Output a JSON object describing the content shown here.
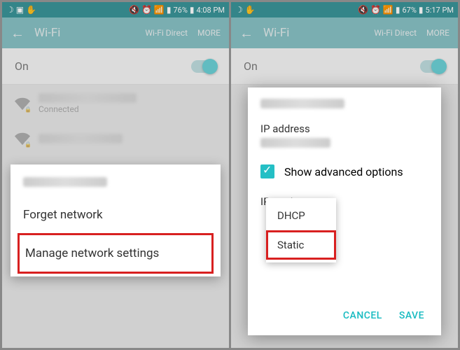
{
  "left": {
    "status": {
      "battery_pct": "76%",
      "time": "4:08 PM"
    },
    "appbar": {
      "title": "Wi-Fi",
      "direct": "Wi-Fi Direct",
      "more": "MORE"
    },
    "toggle_label": "On",
    "network1_status": "Connected",
    "menu": {
      "forget": "Forget network",
      "manage": "Manage network settings"
    }
  },
  "right": {
    "status": {
      "battery_pct": "67%",
      "time": "5:17 PM"
    },
    "appbar": {
      "title": "Wi-Fi",
      "direct": "Wi-Fi Direct",
      "more": "MORE"
    },
    "toggle_label": "On",
    "dialog": {
      "ip_label": "IP address",
      "show_adv": "Show advanced options",
      "ip_settings": "IP settings",
      "dhcp": "DHCP",
      "static": "Static",
      "cancel": "CANCEL",
      "save": "SAVE"
    }
  }
}
